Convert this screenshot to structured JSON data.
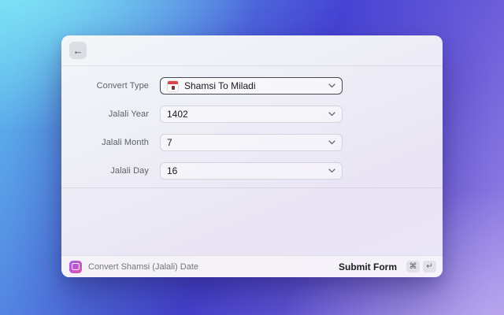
{
  "window": {
    "header": {
      "back_glyph": "←",
      "back_icon_name": "arrow-left-icon"
    },
    "form": {
      "fields": [
        {
          "label": "Convert Type",
          "value": "Shamsi To Miladi",
          "icon": "calendar-emoji",
          "focused": true
        },
        {
          "label": "Jalali Year",
          "value": "1402"
        },
        {
          "label": "Jalali Month",
          "value": "7"
        },
        {
          "label": "Jalali Day",
          "value": "16"
        }
      ],
      "dropdown_icon": "chevron-down"
    },
    "footer": {
      "app_icon": "extension-logo",
      "command_title": "Convert Shamsi (Jalali) Date",
      "primary_action_label": "Submit Form",
      "shortcut_keys": [
        "⌘",
        "↵"
      ]
    }
  },
  "colors": {
    "accent_focus_border": "#26282e",
    "calendar_red": "#d9464e",
    "app_icon_gradient_start": "#9f63e4",
    "app_icon_gradient_end": "#e057a8",
    "background_cyan": "#7fe3f5",
    "background_indigo": "#4643d4",
    "background_purple": "#9a88e5"
  }
}
